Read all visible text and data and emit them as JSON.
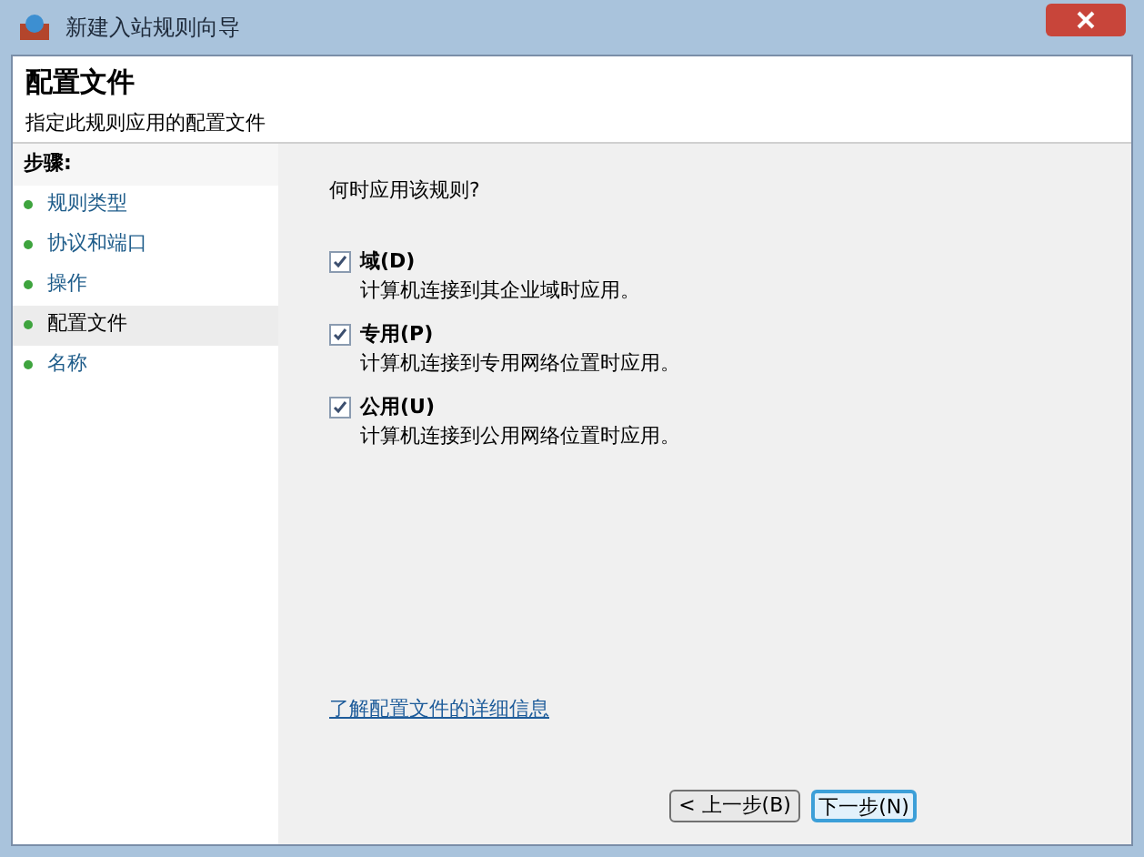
{
  "window": {
    "title": "新建入站规则向导"
  },
  "header": {
    "title": "配置文件",
    "subtitle": "指定此规则应用的配置文件"
  },
  "steps": {
    "heading": "步骤:",
    "items": [
      {
        "label": "规则类型",
        "selected": false
      },
      {
        "label": "协议和端口",
        "selected": false
      },
      {
        "label": "操作",
        "selected": false
      },
      {
        "label": "配置文件",
        "selected": true
      },
      {
        "label": "名称",
        "selected": false
      }
    ]
  },
  "question": "何时应用该规则?",
  "options": [
    {
      "label": "域(D)",
      "description": "计算机连接到其企业域时应用。",
      "checked": true
    },
    {
      "label": "专用(P)",
      "description": "计算机连接到专用网络位置时应用。",
      "checked": true
    },
    {
      "label": "公用(U)",
      "description": "计算机连接到公用网络位置时应用。",
      "checked": true
    }
  ],
  "link": "了解配置文件的详细信息",
  "buttons": {
    "back": "< 上一步(B)",
    "next": "下一步(N)"
  }
}
